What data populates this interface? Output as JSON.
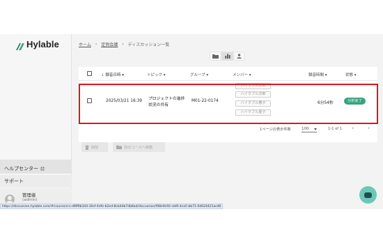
{
  "app": {
    "brand": "Hylable",
    "brand_color": "#2f7d5a"
  },
  "sidebar": {
    "help_center": "ヘルプセンター",
    "support": "サポート",
    "user": {
      "name": "管理者",
      "role": "(admin)"
    }
  },
  "breadcrumb": [
    "ホーム",
    "定例会議",
    "ディスカッション一覧"
  ],
  "view_toggle": {
    "options": [
      "folder-icon",
      "bar-chart-icon",
      "person-icon"
    ],
    "active": "bar-chart-icon"
  },
  "table": {
    "columns": {
      "date": "録音日時",
      "topic": "トピック",
      "group": "グループ",
      "members": "メンバー",
      "duration": "録音時間",
      "status": "状態"
    },
    "rows": [
      {
        "date": "2025/03/21 16:39",
        "topic_line1": "プロジェクトの進捗",
        "topic_line2": "状況の共有",
        "group": "M01-22-0174",
        "members": [
          "ハイラブル太郎",
          "ハイラブル次郎",
          "ハイラブル春子",
          "ハイラブル夏子"
        ],
        "duration": "6分54秒",
        "status": "分析完了"
      }
    ]
  },
  "pagination": {
    "per_page_label": "1ページの表示件数",
    "per_page": "100",
    "range": "1-1 of 1"
  },
  "actions": {
    "delete": "削除",
    "move": "別のコースへ移動"
  },
  "status_bar": {
    "url": "https://discussion.hylable.com/#/course/crs-d9ff9b344-30cf-4dfe-b2ed-8cb44b7db8ad/discussion/f08e9c92-cbf0-4ca5-bb71-0d024421ac46"
  },
  "colors": {
    "status_badge": "#36a47c",
    "highlight_border": "#e0141b",
    "fab": "#6cc8b6"
  }
}
